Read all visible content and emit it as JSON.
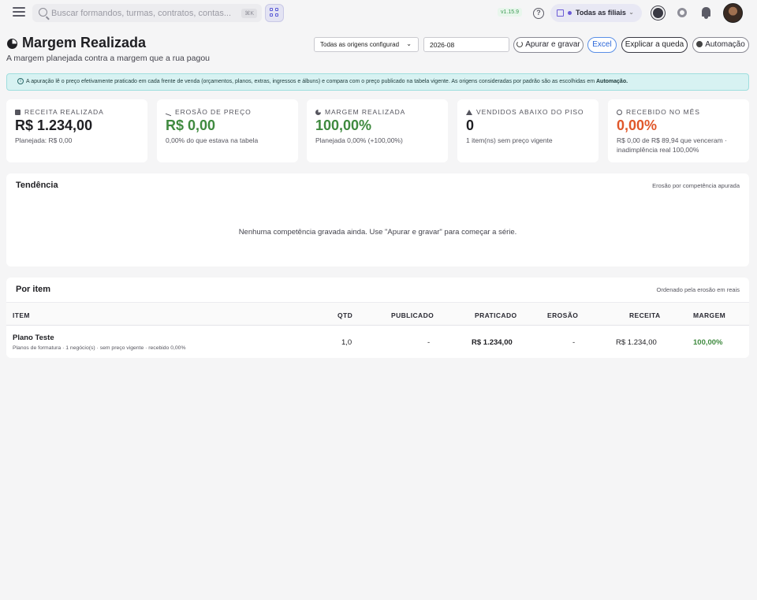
{
  "topbar": {
    "search_placeholder": "Buscar formandos, turmas, contratos, contas...",
    "search_shortcut": "⌘K",
    "version": "v1.15.9",
    "branch_selector": "Todas as filiais",
    "help_label": "?"
  },
  "header": {
    "title": "Margem Realizada",
    "subtitle": "A margem planejada contra a margem que a rua pagou",
    "origins_select": "Todas as origens configurad",
    "period_value": "2026-08",
    "buttons": {
      "apurar": "Apurar e gravar",
      "excel": "Excel",
      "explicar": "Explicar a queda",
      "automacao": "Automação"
    }
  },
  "banner": {
    "text": "A apuração lê o preço efetivamente praticado em cada frente de venda (orçamentos, planos, extras, ingressos e álbuns) e compara com o preço publicado na tabela vigente. As origens consideradas por padrão são as escolhidas em ",
    "link": "Automação."
  },
  "kpis": [
    {
      "label": "RECEITA REALIZADA",
      "value": "R$ 1.234,00",
      "sub": "Planejada: R$ 0,00",
      "color": "#1f1f23"
    },
    {
      "label": "EROSÃO DE PREÇO",
      "value": "R$ 0,00",
      "sub": "0,00% do que estava na tabela",
      "color": "#3f8a3f"
    },
    {
      "label": "MARGEM REALIZADA",
      "value": "100,00%",
      "sub": "Planejada 0,00% (+100,00%)",
      "color": "#3f8a3f"
    },
    {
      "label": "VENDIDOS ABAIXO DO PISO",
      "value": "0",
      "sub": "1 item(ns) sem preço vigente",
      "color": "#1f1f23"
    },
    {
      "label": "RECEBIDO NO MÊS",
      "value": "0,00%",
      "sub": "R$ 0,00 de R$ 89,94 que venceram · inadimplência real 100,00%",
      "color": "#e0572a"
    }
  ],
  "trend": {
    "title": "Tendência",
    "note": "Erosão por competência apurada",
    "empty": "Nenhuma competência gravada ainda. Use \"Apurar e gravar\" para começar a série."
  },
  "items": {
    "title": "Por item",
    "note": "Ordenado pela erosão em reais",
    "columns": {
      "item": "ITEM",
      "qtd": "QTD",
      "publicado": "PUBLICADO",
      "praticado": "PRATICADO",
      "erosao": "EROSÃO",
      "receita": "RECEITA",
      "margem": "MARGEM"
    },
    "rows": [
      {
        "name": "Plano Teste",
        "desc": "Planos de formatura · 1 negócio(s) · sem preço vigente · recebido 0,00%",
        "qtd": "1,0",
        "publicado": "-",
        "praticado": "R$ 1.234,00",
        "erosao": "-",
        "receita": "R$ 1.234,00",
        "margem": "100,00%"
      }
    ]
  }
}
